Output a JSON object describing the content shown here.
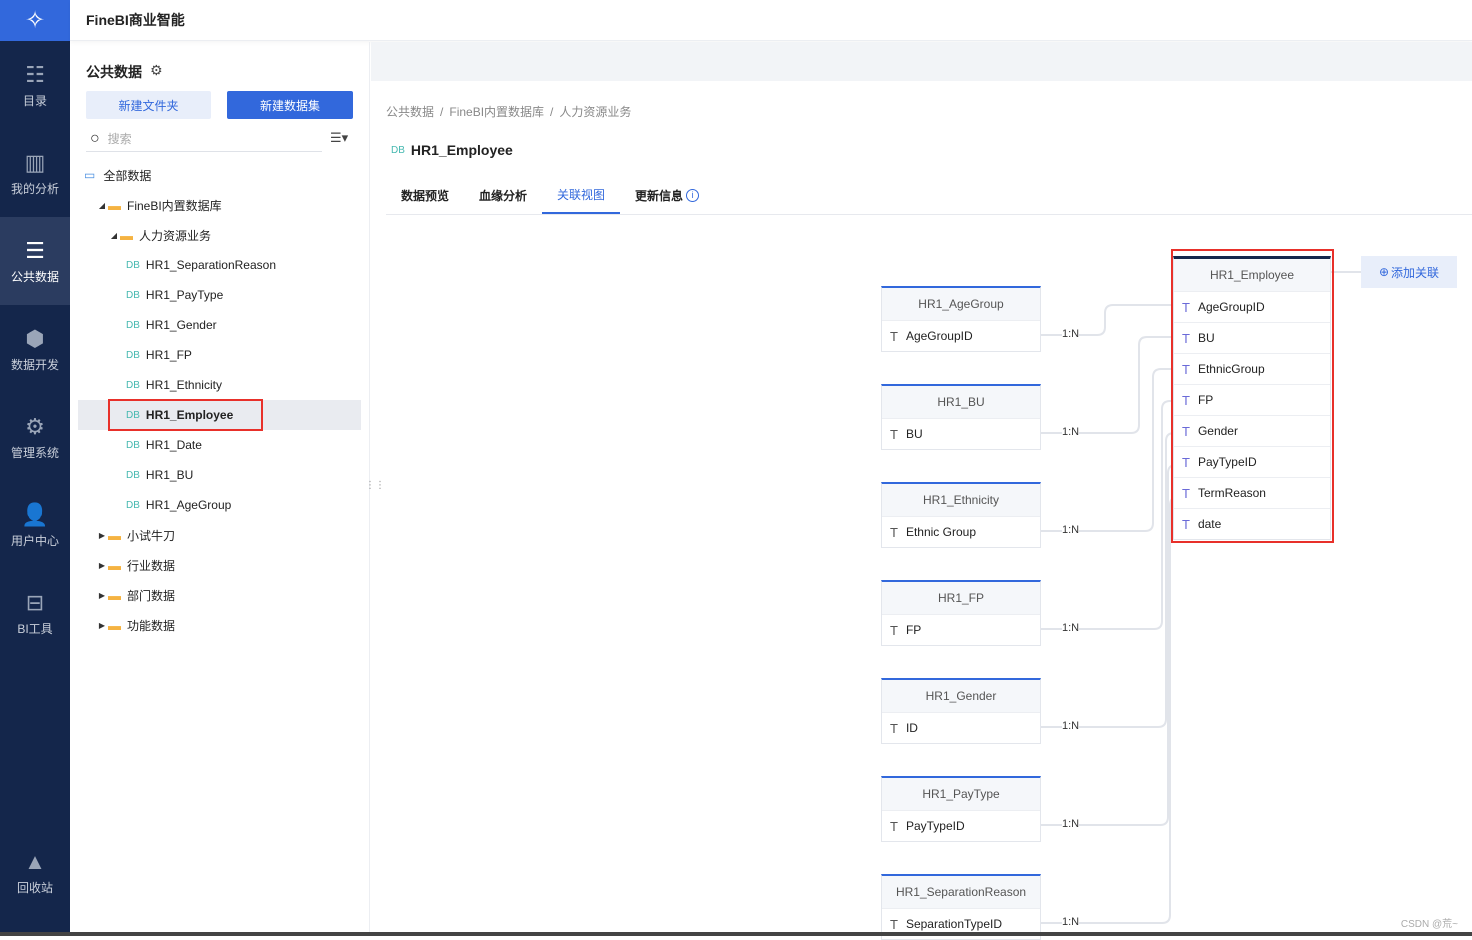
{
  "app": {
    "title": "FineBI商业智能"
  },
  "nav": {
    "items": [
      {
        "label": "目录",
        "icon": "catalog-icon"
      },
      {
        "label": "我的分析",
        "icon": "analysis-icon"
      },
      {
        "label": "公共数据",
        "icon": "public-data-icon",
        "active": true
      },
      {
        "label": "数据开发",
        "icon": "data-dev-icon"
      },
      {
        "label": "管理系统",
        "icon": "admin-icon"
      },
      {
        "label": "用户中心",
        "icon": "user-icon"
      },
      {
        "label": "BI工具",
        "icon": "toolbox-icon"
      }
    ],
    "bottom": {
      "label": "回收站",
      "icon": "recycle-icon"
    }
  },
  "tree": {
    "title": "公共数据",
    "new_folder": "新建文件夹",
    "new_dataset": "新建数据集",
    "search_placeholder": "搜索",
    "root": "全部数据",
    "nodes": [
      {
        "label": "FineBI内置数据库",
        "type": "folder",
        "level": 1,
        "expanded": true
      },
      {
        "label": "人力资源业务",
        "type": "folder",
        "level": 2,
        "expanded": true
      },
      {
        "label": "HR1_SeparationReason",
        "type": "db",
        "level": 3
      },
      {
        "label": "HR1_PayType",
        "type": "db",
        "level": 3
      },
      {
        "label": "HR1_Gender",
        "type": "db",
        "level": 3
      },
      {
        "label": "HR1_FP",
        "type": "db",
        "level": 3
      },
      {
        "label": "HR1_Ethnicity",
        "type": "db",
        "level": 3
      },
      {
        "label": "HR1_Employee",
        "type": "db",
        "level": 3,
        "selected": true
      },
      {
        "label": "HR1_Date",
        "type": "db",
        "level": 3
      },
      {
        "label": "HR1_BU",
        "type": "db",
        "level": 3
      },
      {
        "label": "HR1_AgeGroup",
        "type": "db",
        "level": 3
      },
      {
        "label": "小试牛刀",
        "type": "folder",
        "level": 1
      },
      {
        "label": "行业数据",
        "type": "folder",
        "level": 1
      },
      {
        "label": "部门数据",
        "type": "folder",
        "level": 1
      },
      {
        "label": "功能数据",
        "type": "folder",
        "level": 1
      }
    ],
    "db_tag": "DB"
  },
  "breadcrumb": [
    "公共数据",
    "FineBI内置数据库",
    "人力资源业务"
  ],
  "page_title": "HR1_Employee",
  "tabs": [
    {
      "label": "数据预览"
    },
    {
      "label": "血缘分析"
    },
    {
      "label": "关联视图",
      "active": true
    },
    {
      "label": "更新信息"
    }
  ],
  "diagram": {
    "main": {
      "name": "HR1_Employee",
      "fields": [
        "AgeGroupID",
        "BU",
        "EthnicGroup",
        "FP",
        "Gender",
        "PayTypeID",
        "TermReason",
        "date"
      ]
    },
    "add_relation": "添加关联",
    "related": [
      {
        "name": "HR1_AgeGroup",
        "field": "AgeGroupID",
        "relation": "1:N",
        "target": 0
      },
      {
        "name": "HR1_BU",
        "field": "BU",
        "relation": "1:N",
        "target": 1
      },
      {
        "name": "HR1_Ethnicity",
        "field": "Ethnic Group",
        "relation": "1:N",
        "target": 2
      },
      {
        "name": "HR1_FP",
        "field": "FP",
        "relation": "1:N",
        "target": 3
      },
      {
        "name": "HR1_Gender",
        "field": "ID",
        "relation": "1:N",
        "target": 4
      },
      {
        "name": "HR1_PayType",
        "field": "PayTypeID",
        "relation": "1:N",
        "target": 5
      },
      {
        "name": "HR1_SeparationReason",
        "field": "SeparationTypeID",
        "relation": "1:N",
        "target": 6
      }
    ]
  },
  "watermark": "CSDN @荒~",
  "colors": {
    "accent": "#3268dc",
    "nav_bg": "#14264b",
    "highlight": "#e8302a"
  }
}
